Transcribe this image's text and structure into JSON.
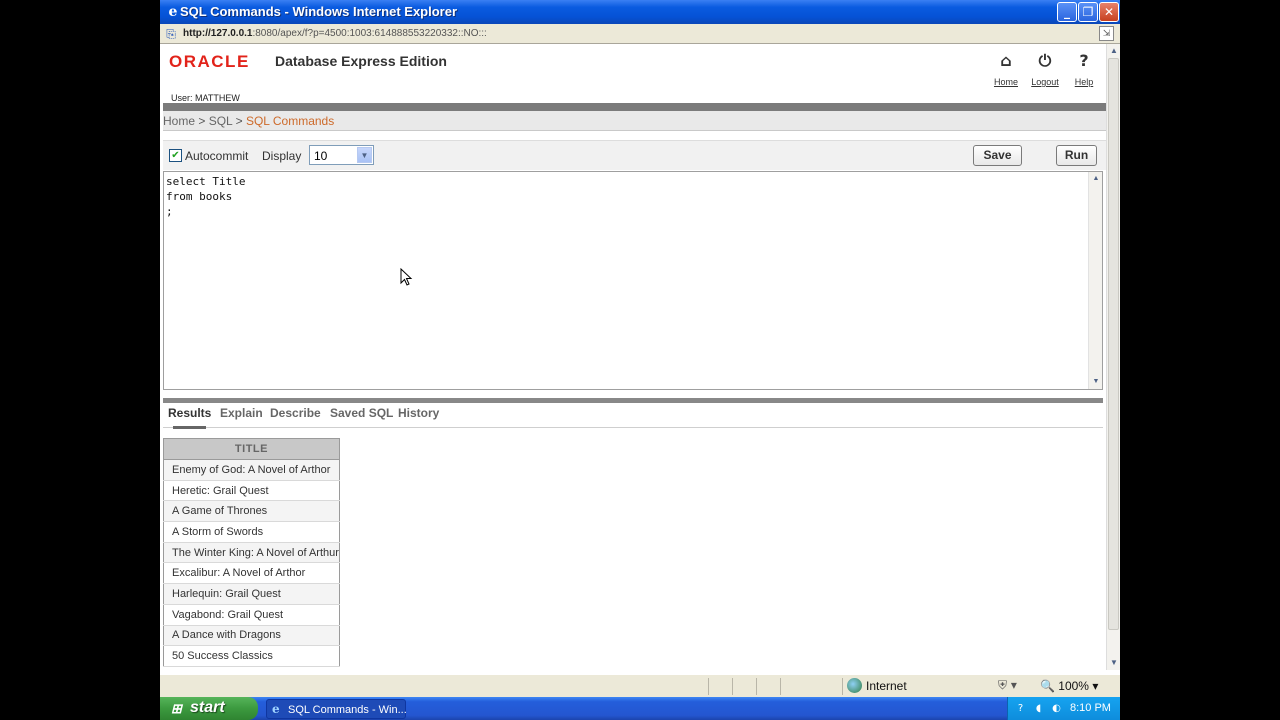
{
  "window": {
    "title": "SQL Commands - Windows Internet Explorer",
    "minimize": "_",
    "restore": "❐",
    "close": "✕"
  },
  "address": {
    "url_host": "http://127.0.0.1",
    "url_rest": ":8080/apex/f?p=4500:1003:614888553220332::NO:::"
  },
  "header": {
    "logo": "ORACLE",
    "product": "Database Express Edition",
    "user_label": "User:",
    "user_name": "MATTHEW",
    "nav": [
      {
        "label": "Home",
        "icon": "home-icon"
      },
      {
        "label": "Logout",
        "icon": "power-icon"
      },
      {
        "label": "Help",
        "icon": "help-icon"
      }
    ]
  },
  "breadcrumb": {
    "home": "Home",
    "sep": " > ",
    "sql": "SQL",
    "current": "SQL Commands"
  },
  "toolbar": {
    "autocommit_label": "Autocommit",
    "autocommit_checked": true,
    "display_label": "Display",
    "display_value": "10",
    "save_label": "Save",
    "run_label": "Run"
  },
  "editor": {
    "query": "select Title\nfrom books\n;"
  },
  "tabs": [
    "Results",
    "Explain",
    "Describe",
    "Saved SQL",
    "History"
  ],
  "results": {
    "column": "TITLE",
    "rows": [
      "Enemy of God: A Novel of Arthor",
      "Heretic: Grail Quest",
      "A Game of Thrones",
      "A Storm of Swords",
      "The Winter King: A Novel of Arthur",
      "Excalibur: A Novel of Arthor",
      "Harlequin: Grail Quest",
      "Vagabond: Grail Quest",
      "A Dance with Dragons",
      "50 Success Classics"
    ]
  },
  "statusbar": {
    "zone": "Internet",
    "zoom": "100%"
  },
  "taskbar": {
    "start": "start",
    "task": "SQL Commands - Win...",
    "clock": "8:10 PM"
  }
}
